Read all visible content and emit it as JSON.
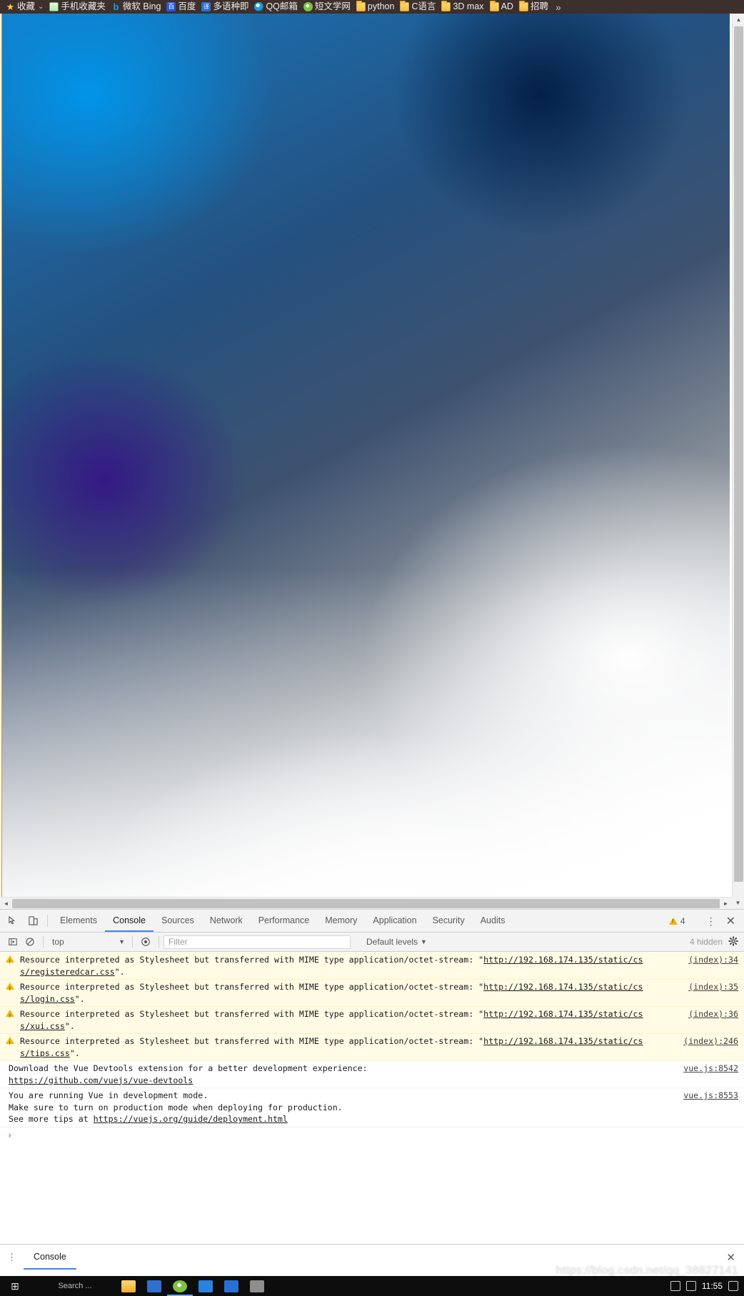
{
  "bookmark_bar": {
    "items": [
      {
        "label": "收藏",
        "icon": "star-icon",
        "has_caret": true
      },
      {
        "label": "手机收藏夹",
        "icon": "phone-icon",
        "has_caret": false
      },
      {
        "label": "微软 Bing",
        "icon": "bing-icon",
        "has_caret": false
      },
      {
        "label": "百度",
        "icon": "baidu-icon",
        "has_caret": false
      },
      {
        "label": "多语种即",
        "icon": "translate-icon",
        "has_caret": false
      },
      {
        "label": "QQ邮箱",
        "icon": "qq-mail-icon",
        "has_caret": false
      },
      {
        "label": "短文学网",
        "icon": "duanwen-icon",
        "has_caret": false
      },
      {
        "label": "python",
        "icon": "folder-icon",
        "has_caret": false
      },
      {
        "label": "C语言",
        "icon": "folder-icon",
        "has_caret": false
      },
      {
        "label": "3D max",
        "icon": "folder-icon",
        "has_caret": false
      },
      {
        "label": "AD",
        "icon": "folder-icon",
        "has_caret": false
      },
      {
        "label": "招聘",
        "icon": "folder-icon",
        "has_caret": false
      }
    ],
    "overflow_label": "»"
  },
  "devtools": {
    "tabs": [
      {
        "label": "Elements",
        "active": false
      },
      {
        "label": "Console",
        "active": true
      },
      {
        "label": "Sources",
        "active": false
      },
      {
        "label": "Network",
        "active": false
      },
      {
        "label": "Performance",
        "active": false
      },
      {
        "label": "Memory",
        "active": false
      },
      {
        "label": "Application",
        "active": false
      },
      {
        "label": "Security",
        "active": false
      },
      {
        "label": "Audits",
        "active": false
      }
    ],
    "warning_count": "4",
    "kebab_label": "⋮",
    "close_label": "✕",
    "accent_color": "#4285f4",
    "warning_color": "#f5b400",
    "filter_bar": {
      "execute_icon": "execute-icon",
      "clear_icon": "clear-console-icon",
      "context_value": "top",
      "context_caret": "▼",
      "eye_icon": "live-expression-icon",
      "filter_placeholder": "Filter",
      "filter_value": "",
      "levels_value": "Default levels",
      "levels_caret": "▼",
      "hidden_count": "4 hidden",
      "settings_icon": "gear-icon"
    },
    "messages": [
      {
        "type": "warning",
        "text_pre": "Resource interpreted as Stylesheet but transferred with MIME type application/octet-stream: \"",
        "link": "http://192.168.174.135/static/css/registeredcar.css",
        "text_post": "\".",
        "source": "(index):34"
      },
      {
        "type": "warning",
        "text_pre": "Resource interpreted as Stylesheet but transferred with MIME type application/octet-stream: \"",
        "link": "http://192.168.174.135/static/css/login.css",
        "text_post": "\".",
        "source": "(index):35"
      },
      {
        "type": "warning",
        "text_pre": "Resource interpreted as Stylesheet but transferred with MIME type application/octet-stream: \"",
        "link": "http://192.168.174.135/static/css/xui.css",
        "text_post": "\".",
        "source": "(index):36"
      },
      {
        "type": "warning",
        "text_pre": "Resource interpreted as Stylesheet but transferred with MIME type application/octet-stream: \"",
        "link": "http://192.168.174.135/static/css/tips.css",
        "text_post": "\".",
        "source": "(index):246"
      },
      {
        "type": "info",
        "text_pre": "Download the Vue Devtools extension for a better development experience:",
        "link": "https://github.com/vuejs/vue-devtools",
        "text_post": "",
        "source": "vue.js:8542"
      },
      {
        "type": "info",
        "text_pre": "You are running Vue in development mode.\nMake sure to turn on production mode when deploying for production.\nSee more tips at ",
        "link": "https://vuejs.org/guide/deployment.html",
        "text_post": "",
        "source": "vue.js:8553"
      }
    ],
    "prompt_caret": "›",
    "prompt_value": "",
    "drawer": {
      "kebab_label": "⋮",
      "tab_label": "Console",
      "close_label": "✕"
    }
  },
  "watermark": {
    "text": "https://blog.csdn.net/qq_38827141"
  },
  "taskbar": {
    "start_label": "⊞",
    "search_placeholder": "Search ...",
    "clock": "11:55",
    "items": [
      {
        "name": "file-explorer",
        "style": "sq-folder",
        "active": false
      },
      {
        "name": "app-blue",
        "style": "sq-blue",
        "active": false
      },
      {
        "name": "app-green",
        "style": "sq-green",
        "active": true
      },
      {
        "name": "app-blue2",
        "style": "sq-blue2",
        "active": false
      },
      {
        "name": "app-blue3",
        "style": "sq-blue3",
        "active": false
      },
      {
        "name": "app-gray",
        "style": "sq-gray",
        "active": false
      }
    ]
  }
}
